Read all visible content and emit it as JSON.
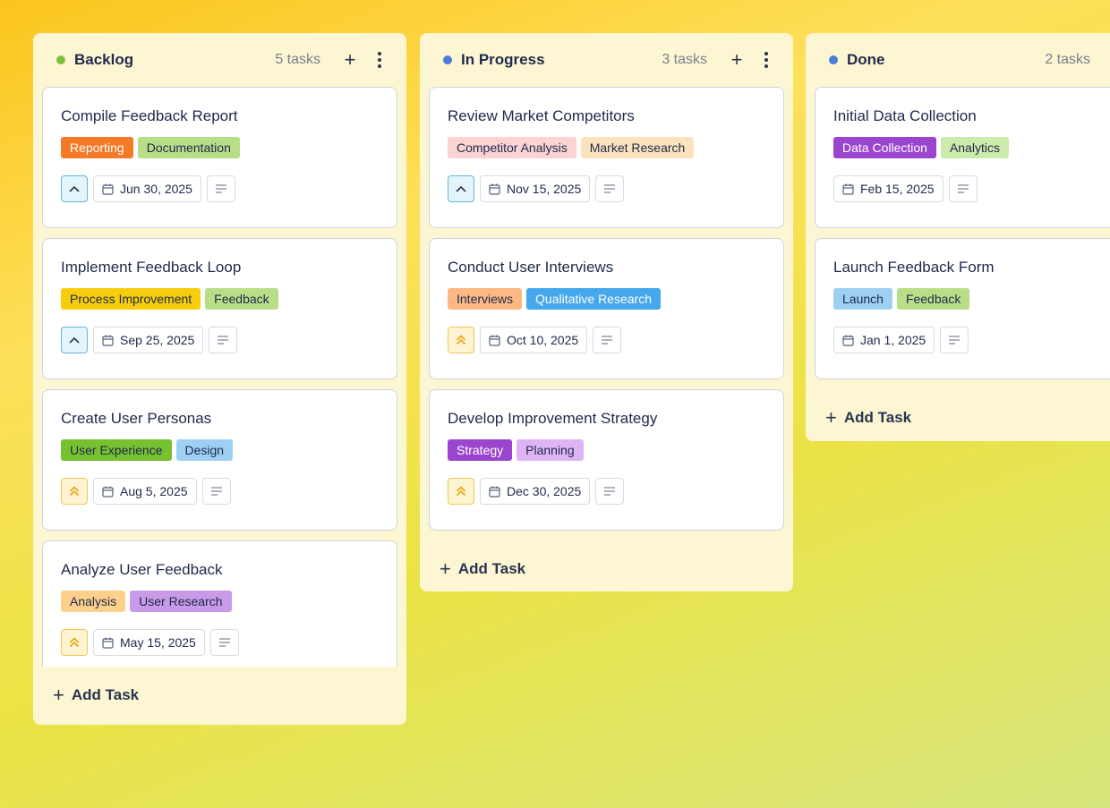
{
  "columns": [
    {
      "title": "Backlog",
      "count": "5 tasks",
      "dot_color": "#7cc242",
      "add_label": "Add Task",
      "cards": [
        {
          "title": "Compile Feedback Report",
          "priority": "up",
          "date": "Jun 30, 2025",
          "tags": [
            {
              "label": "Reporting",
              "bg": "#f47a28",
              "fg": "#ffffff"
            },
            {
              "label": "Documentation",
              "bg": "#b8de88",
              "fg": "#1f2a4a"
            }
          ]
        },
        {
          "title": "Implement Feedback Loop",
          "priority": "up",
          "date": "Sep 25, 2025",
          "tags": [
            {
              "label": "Process Improvement",
              "bg": "#f7ce0e",
              "fg": "#1f2a4a"
            },
            {
              "label": "Feedback",
              "bg": "#b8de88",
              "fg": "#1f2a4a"
            }
          ]
        },
        {
          "title": "Create User Personas",
          "priority": "high",
          "date": "Aug 5, 2025",
          "tags": [
            {
              "label": "User Experience",
              "bg": "#75c12f",
              "fg": "#1f2a4a"
            },
            {
              "label": "Design",
              "bg": "#9dd0f3",
              "fg": "#1f2a4a"
            }
          ]
        },
        {
          "title": "Analyze User Feedback",
          "priority": "high",
          "date": "May 15, 2025",
          "tags": [
            {
              "label": "Analysis",
              "bg": "#fdd08c",
              "fg": "#1f2a4a"
            },
            {
              "label": "User Research",
              "bg": "#c99ae8",
              "fg": "#1f2a4a"
            }
          ]
        }
      ]
    },
    {
      "title": "In Progress",
      "count": "3 tasks",
      "dot_color": "#4a7bd8",
      "add_label": "Add Task",
      "cards": [
        {
          "title": "Review Market Competitors",
          "priority": "up",
          "date": "Nov 15, 2025",
          "tags": [
            {
              "label": "Competitor Analysis",
              "bg": "#fbd3d3",
              "fg": "#1f2a4a"
            },
            {
              "label": "Market Research",
              "bg": "#fde3bd",
              "fg": "#1f2a4a"
            }
          ]
        },
        {
          "title": "Conduct User Interviews",
          "priority": "high",
          "date": "Oct 10, 2025",
          "tags": [
            {
              "label": "Interviews",
              "bg": "#fdb884",
              "fg": "#1f2a4a"
            },
            {
              "label": "Qualitative Research",
              "bg": "#45a7ec",
              "fg": "#ffffff"
            }
          ]
        },
        {
          "title": "Develop Improvement Strategy",
          "priority": "high",
          "date": "Dec 30, 2025",
          "tags": [
            {
              "label": "Strategy",
              "bg": "#9b45cf",
              "fg": "#ffffff"
            },
            {
              "label": "Planning",
              "bg": "#dfb4f5",
              "fg": "#1f2a4a"
            }
          ]
        }
      ]
    },
    {
      "title": "Done",
      "count": "2 tasks",
      "dot_color": "#4a7bd8",
      "add_label": "Add Task",
      "cards": [
        {
          "title": "Initial Data Collection",
          "priority": "none",
          "date": "Feb 15, 2025",
          "tags": [
            {
              "label": "Data Collection",
              "bg": "#9b45cf",
              "fg": "#ffffff"
            },
            {
              "label": "Analytics",
              "bg": "#cdebaa",
              "fg": "#1f2a4a"
            }
          ]
        },
        {
          "title": "Launch Feedback Form",
          "priority": "none",
          "date": "Jan 1, 2025",
          "tags": [
            {
              "label": "Launch",
              "bg": "#9dd0f3",
              "fg": "#1f2a4a"
            },
            {
              "label": "Feedback",
              "bg": "#b8de88",
              "fg": "#1f2a4a"
            }
          ]
        }
      ]
    }
  ]
}
